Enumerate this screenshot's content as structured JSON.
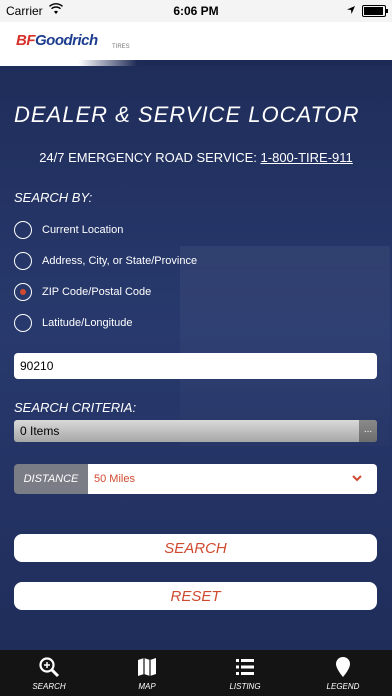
{
  "status_bar": {
    "carrier": "Carrier",
    "time": "6:06 PM"
  },
  "brand": {
    "logo_bf": "BF",
    "logo_rest": "Goodrich",
    "logo_sub": "TIRES"
  },
  "page": {
    "title": "DEALER & SERVICE LOCATOR",
    "emergency_label": "24/7 EMERGENCY ROAD SERVICE:",
    "emergency_phone": "1-800-TIRE-911"
  },
  "search_by": {
    "label": "SEARCH BY:",
    "options": [
      {
        "label": "Current Location",
        "selected": false
      },
      {
        "label": "Address, City, or State/Province",
        "selected": false
      },
      {
        "label": "ZIP Code/Postal Code",
        "selected": true
      },
      {
        "label": "Latitude/Longitude",
        "selected": false
      }
    ]
  },
  "zip_input": {
    "value": "90210"
  },
  "criteria": {
    "label": "SEARCH CRITERIA:",
    "value": "0 Items",
    "more": "..."
  },
  "distance": {
    "label": "DISTANCE",
    "value": "50 Miles"
  },
  "buttons": {
    "search": "SEARCH",
    "reset": "RESET"
  },
  "tabs": [
    {
      "label": "SEARCH",
      "icon": "search-icon"
    },
    {
      "label": "MAP",
      "icon": "map-icon"
    },
    {
      "label": "LISTING",
      "icon": "list-icon"
    },
    {
      "label": "LEGEND",
      "icon": "map-pin-icon"
    }
  ],
  "colors": {
    "accent": "#d04a30",
    "background": "#1f2d5a"
  }
}
